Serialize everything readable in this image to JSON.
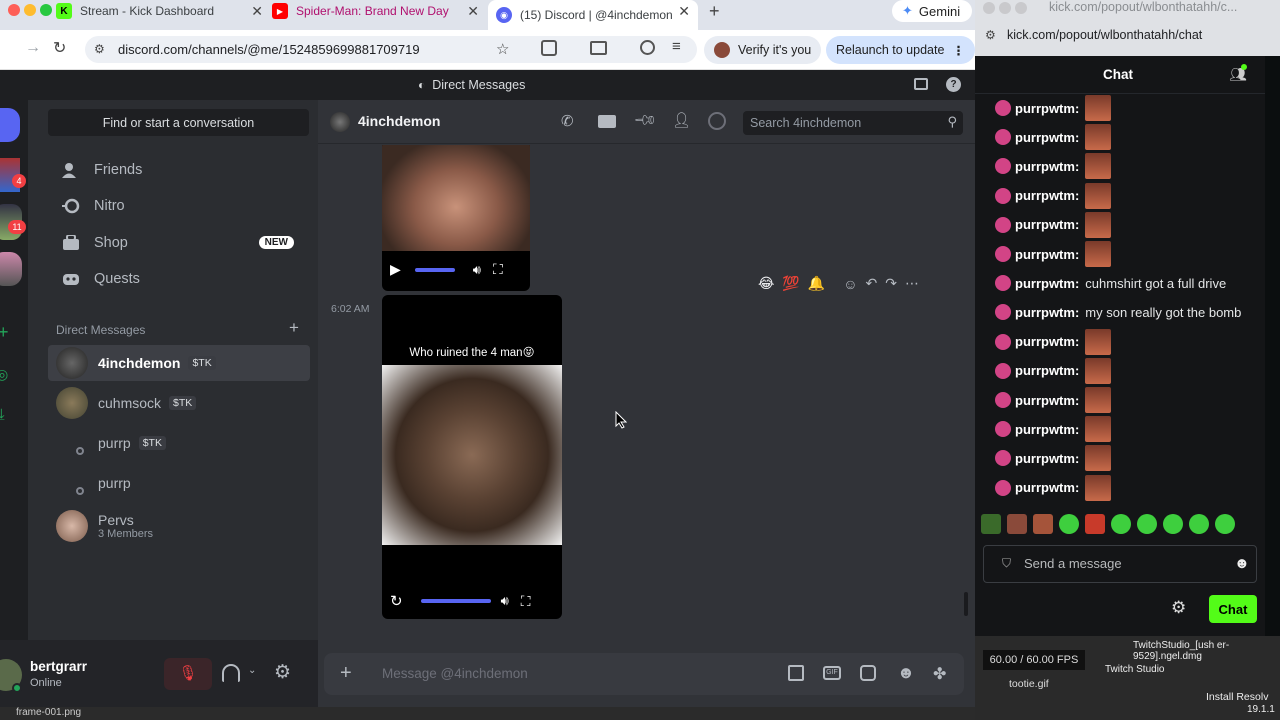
{
  "browser_left": {
    "tabs": [
      {
        "title": "Stream - Kick Dashboard"
      },
      {
        "title": "Spider-Man: Brand New Day"
      },
      {
        "title": "(15) Discord | @4inchdemon"
      }
    ],
    "gemini_label": "Gemini",
    "url": "discord.com/channels/@me/1524859699881709719",
    "verify_label": "Verify it's you",
    "relaunch_label": "Relaunch to update"
  },
  "discord": {
    "title": "Direct Messages",
    "find_placeholder": "Find or start a conversation",
    "nav": [
      {
        "label": "Friends",
        "icon": "friends-icon"
      },
      {
        "label": "Nitro",
        "icon": "nitro-icon"
      },
      {
        "label": "Shop",
        "icon": "shop-icon",
        "badge": "NEW"
      },
      {
        "label": "Quests",
        "icon": "quests-icon"
      }
    ],
    "dm_section_label": "Direct Messages",
    "dms": [
      {
        "name": "4inchdemon",
        "tag": "$TK"
      },
      {
        "name": "cuhmsock",
        "tag": "$TK"
      },
      {
        "name": "purrp",
        "tag": "$TK"
      },
      {
        "name": "purrp",
        "tag": ""
      },
      {
        "name": "Pervs",
        "sub": "3 Members"
      }
    ],
    "user": {
      "name": "bertgrarr",
      "status": "Online"
    },
    "channel_name": "4inchdemon",
    "search_placeholder": "Search 4inchdemon",
    "message_time": "6:02 AM",
    "video_caption": "Who ruined the 4 man😝",
    "message_placeholder": "Message @4inchdemon",
    "reactions": [
      "😂",
      "💯",
      "🔔"
    ]
  },
  "kick": {
    "url": "kick.com/popout/wlbonthatahh/c...",
    "url_full": "kick.com/popout/wlbonthatahh/chat",
    "chat_title": "Chat",
    "messages": [
      {
        "user": "purrpwtm:",
        "text": "",
        "emote": true
      },
      {
        "user": "purrpwtm:",
        "text": "",
        "emote": true
      },
      {
        "user": "purrpwtm:",
        "text": "",
        "emote": true
      },
      {
        "user": "purrpwtm:",
        "text": "",
        "emote": true
      },
      {
        "user": "purrpwtm:",
        "text": "",
        "emote": true
      },
      {
        "user": "purrpwtm:",
        "text": "",
        "emote": true
      },
      {
        "user": "purrpwtm:",
        "text": "cuhmshirt got a full drive",
        "emote": false
      },
      {
        "user": "purrpwtm:",
        "text": "my son really got the bomb",
        "emote": false
      },
      {
        "user": "purrpwtm:",
        "text": "",
        "emote": true
      },
      {
        "user": "purrpwtm:",
        "text": "",
        "emote": true
      },
      {
        "user": "purrpwtm:",
        "text": "",
        "emote": true
      },
      {
        "user": "purrpwtm:",
        "text": "",
        "emote": true
      },
      {
        "user": "purrpwtm:",
        "text": "",
        "emote": true
      },
      {
        "user": "purrpwtm:",
        "text": "",
        "emote": true
      }
    ],
    "send_placeholder": "Send a message",
    "chat_button": "Chat",
    "fps": "60.00 / 60.00 FPS"
  },
  "desktop": {
    "file1": "frame-001.png",
    "file2": "tootie.gif",
    "file3": "TwitchStudio_[ush er-9529].ngel.dmg",
    "file3_sub": "Twitch Studio",
    "file4": "Install Resolv",
    "file4_sub": "19.1.1"
  }
}
